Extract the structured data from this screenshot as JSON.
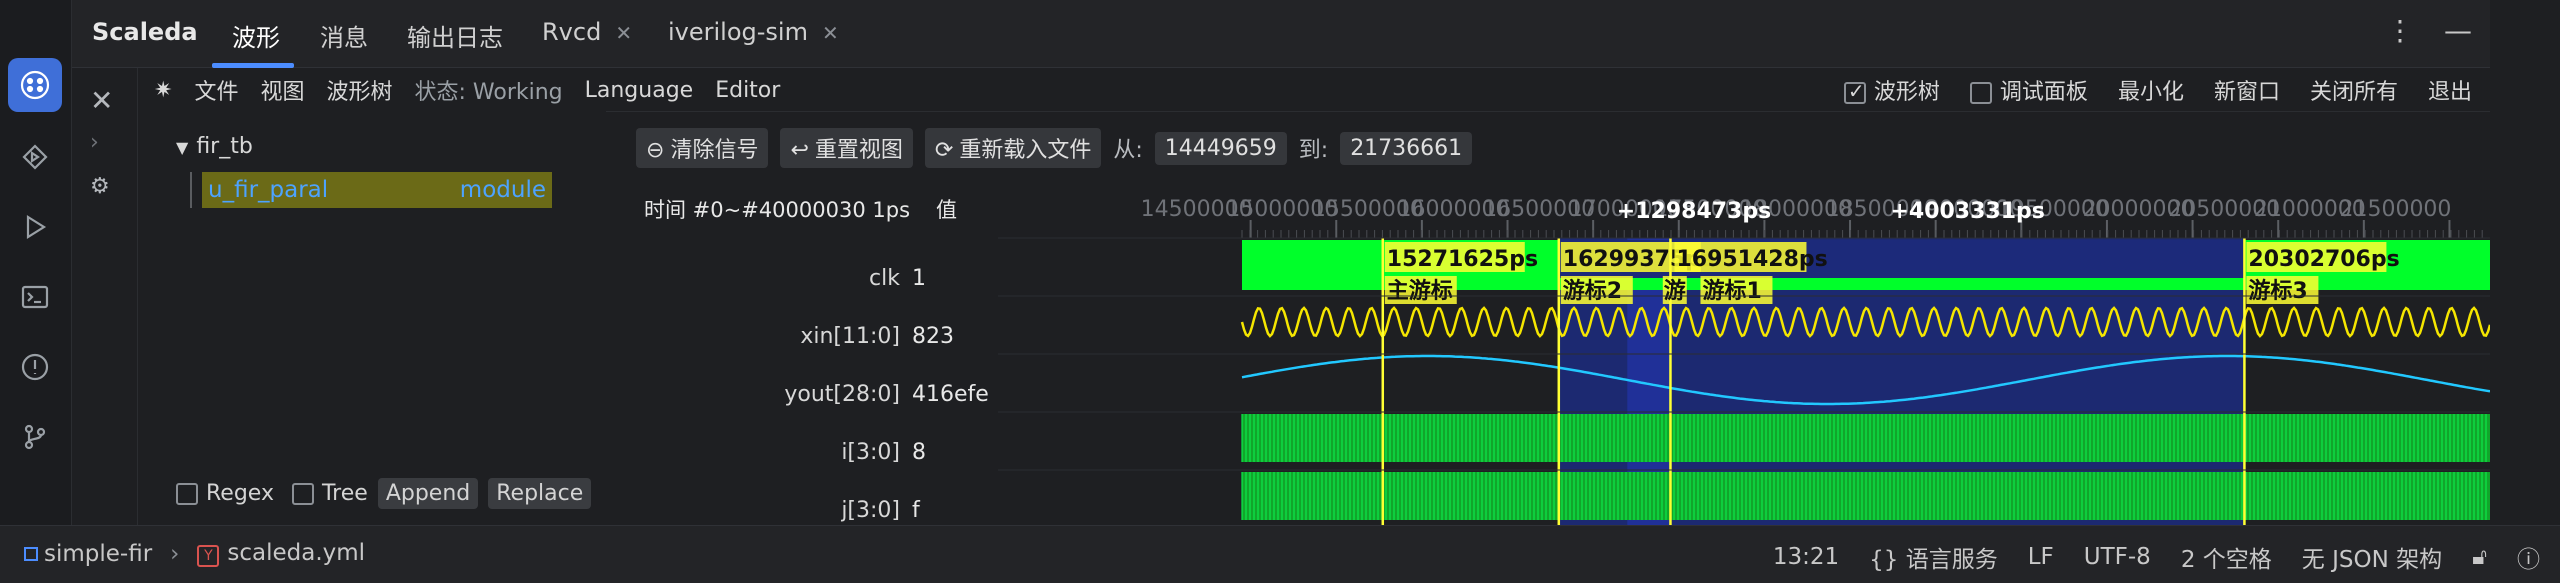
{
  "app": {
    "name": "Scaleda"
  },
  "tabs": [
    {
      "label": "波形",
      "active": true,
      "closable": false
    },
    {
      "label": "消息",
      "active": false,
      "closable": false
    },
    {
      "label": "输出日志",
      "active": false,
      "closable": false
    },
    {
      "label": "Rvcd",
      "active": false,
      "closable": true
    },
    {
      "label": "iverilog-sim",
      "active": false,
      "closable": true
    }
  ],
  "top_icons": {
    "more": "⋮",
    "minimize": "—"
  },
  "left_panel": {
    "menu": {
      "star": "✷",
      "file": "文件",
      "view": "视图",
      "wavetree": "波形树",
      "status": "状态: Working",
      "language": "Language",
      "editor": "Editor"
    },
    "tree": {
      "root": "fir_tb",
      "child_name": "u_fir_paral",
      "child_type": "module"
    },
    "bottom": {
      "regex": "Regex",
      "tree": "Tree",
      "append": "Append",
      "replace": "Replace"
    }
  },
  "main_menu": {
    "wavetree": "波形树",
    "debug_panel": "调试面板",
    "minimize": "最小化",
    "new_window": "新窗口",
    "close_all": "关闭所有",
    "exit": "退出"
  },
  "controls": {
    "clear_signals": "清除信号",
    "reset_view": "重置视图",
    "reload_file": "重新载入文件",
    "from_label": "从:",
    "from_value": "14449659",
    "to_label": "到:",
    "to_value": "21736661"
  },
  "headers": {
    "time": "时间 #0~#40000030 1ps",
    "value": "值"
  },
  "signals": [
    {
      "name": "clk",
      "value": "1"
    },
    {
      "name": "xin[11:0]",
      "value": "823"
    },
    {
      "name": "yout[28:0]",
      "value": "416efe"
    },
    {
      "name": "i[3:0]",
      "value": "8"
    },
    {
      "name": "j[3:0]",
      "value": "f"
    }
  ],
  "ruler": {
    "ticks": [
      "14500000",
      "15000000",
      "15500000",
      "16000000",
      "16500000",
      "17000000",
      "17500000",
      "18000000",
      "18500000",
      "19000000",
      "19500000",
      "20000000",
      "20500000",
      "21000000",
      "21500000"
    ],
    "deltas": [
      "+1298473ps",
      "+4003331ps"
    ]
  },
  "cursors": [
    {
      "time": "15271625ps",
      "name": "主游标"
    },
    {
      "time": "16299375ps",
      "name": "游标2"
    },
    {
      "time": "16951428ps",
      "name": "游标1"
    },
    {
      "time": "20302706ps",
      "name": "游标3"
    }
  ],
  "cursor_extra_label": "游",
  "colors": {
    "clk": "#00ff2a",
    "xin": "#f5e600",
    "yout": "#22c8ff",
    "selection": "#1c2a7a",
    "cursor": "#ffff33",
    "accent": "#3f6fd8"
  },
  "statusbar": {
    "project": "simple-fir",
    "file": "scaleda.yml",
    "position": "13:21",
    "lang_service": "{} 语言服务",
    "eol": "LF",
    "encoding": "UTF-8",
    "indent": "2 个空格",
    "schema": "无 JSON 架构"
  }
}
